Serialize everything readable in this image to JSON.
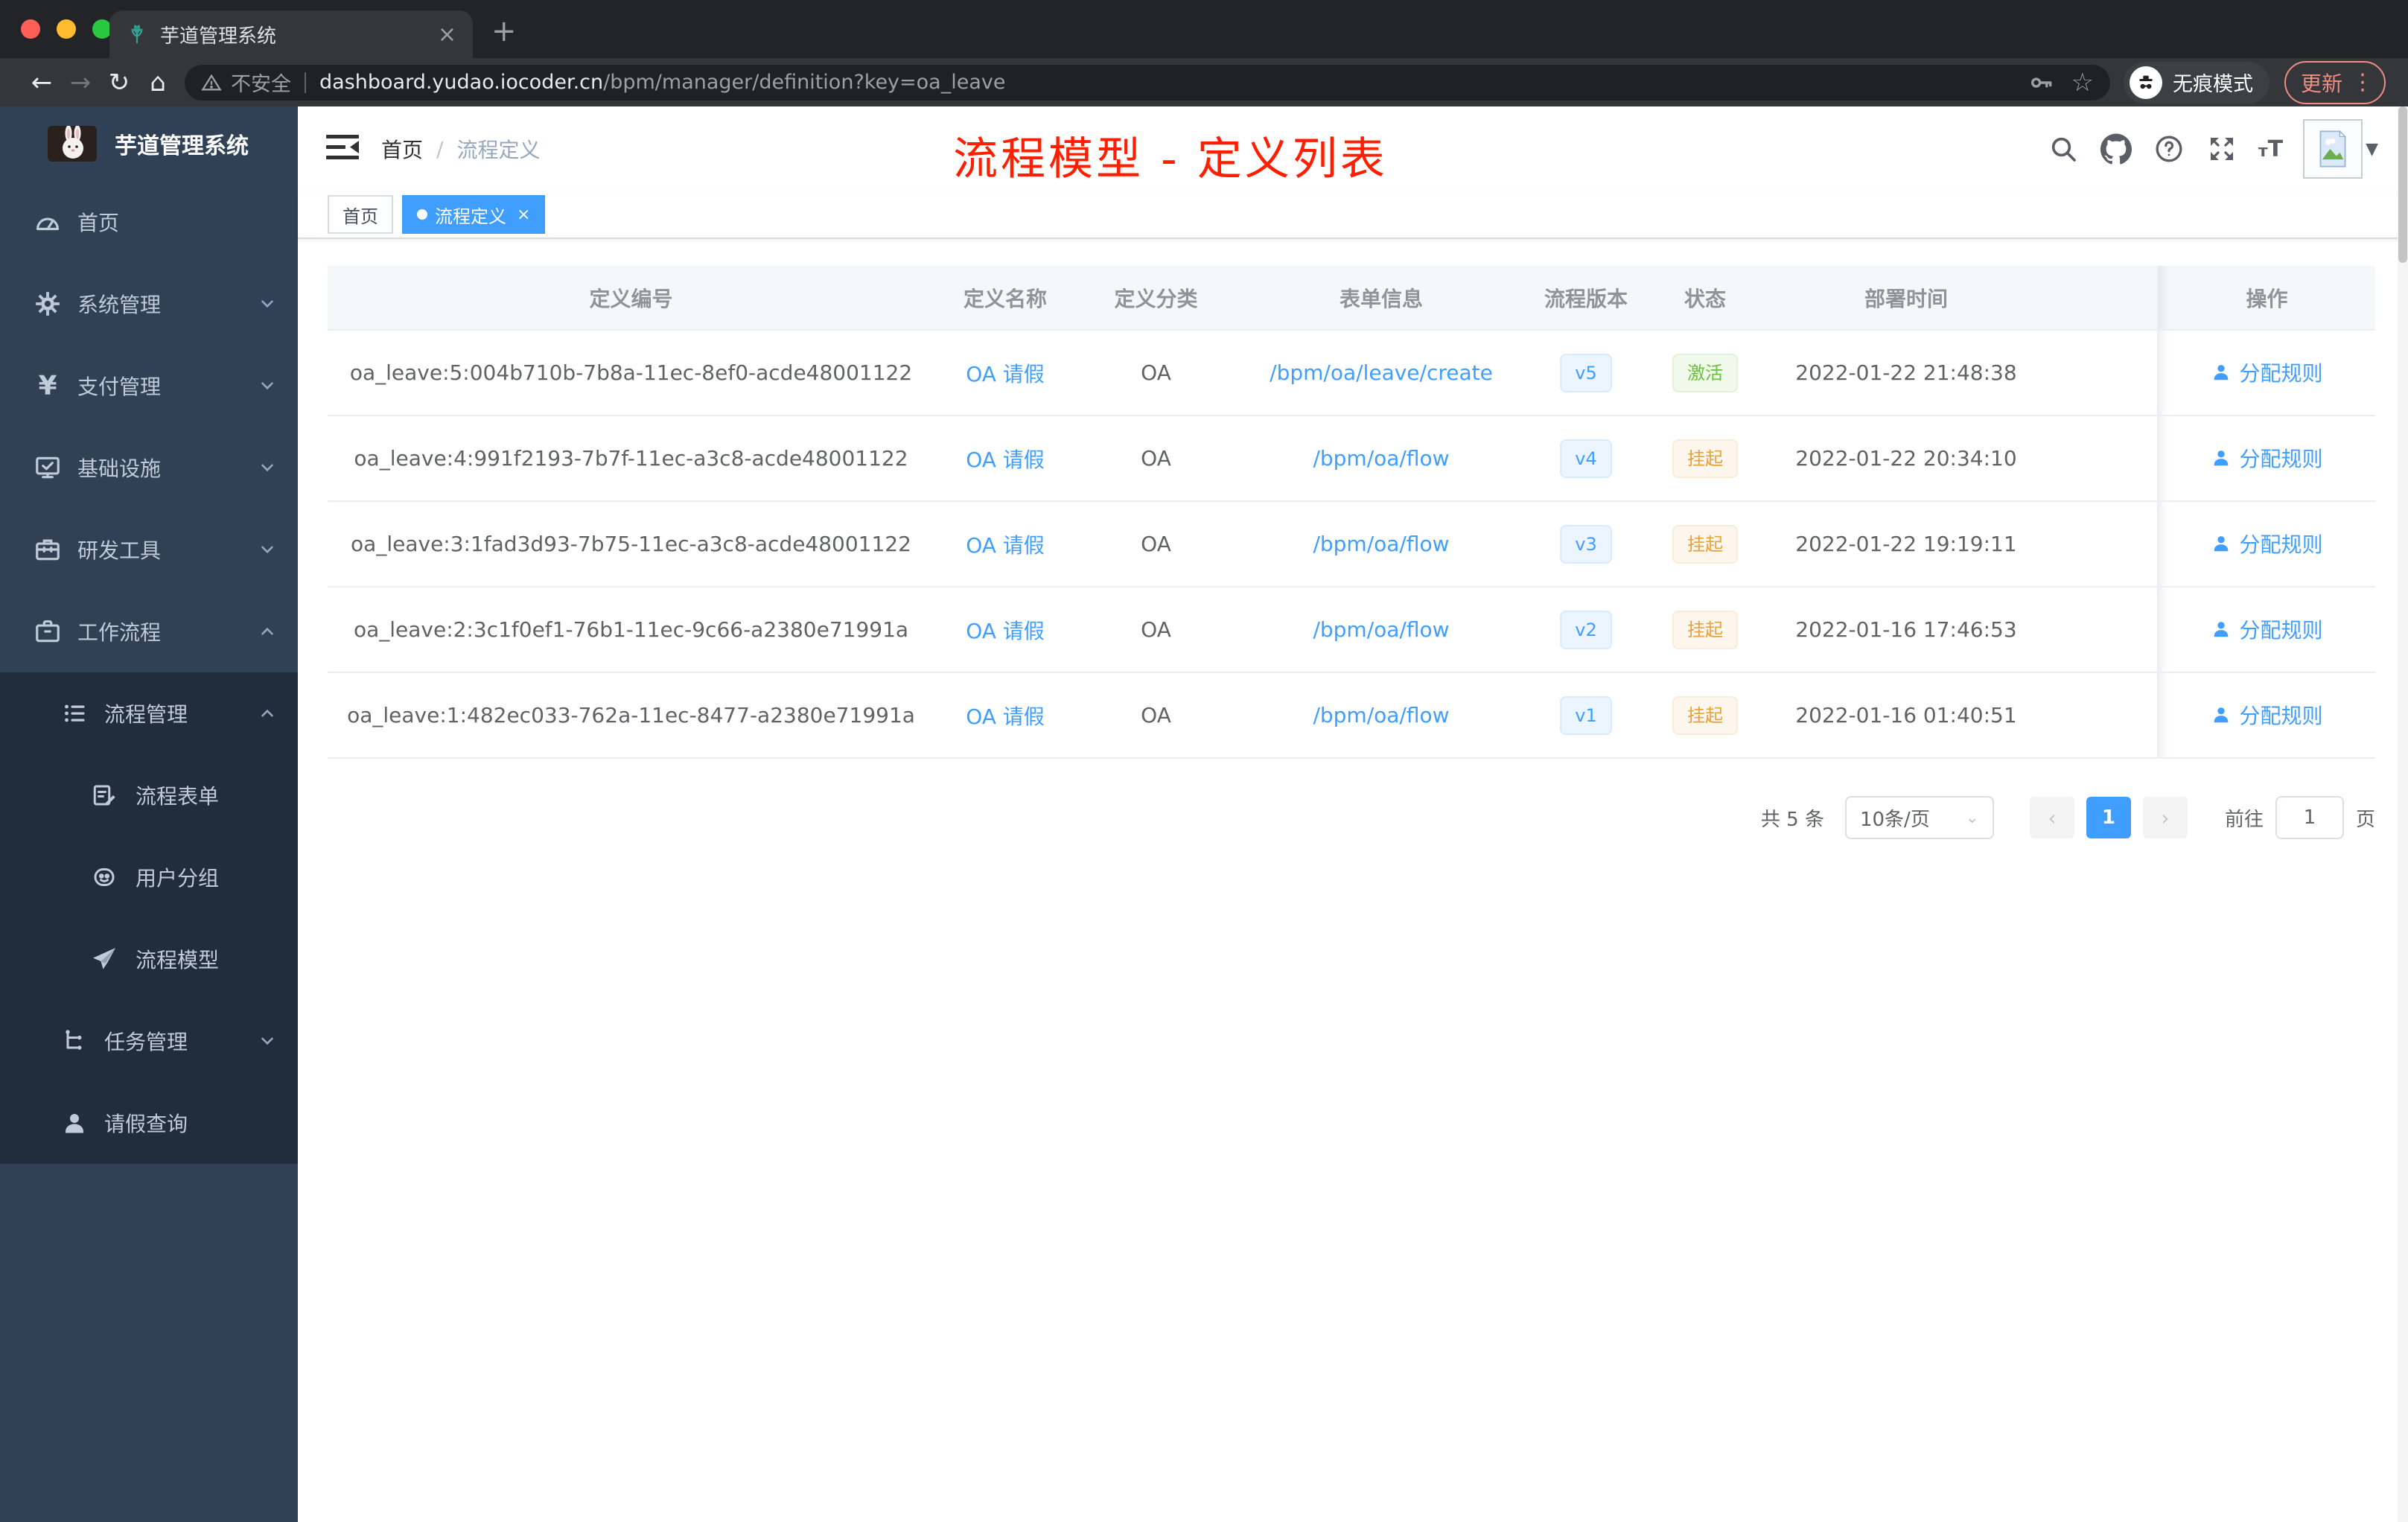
{
  "browser": {
    "tab_title": "芋道管理系统",
    "close_tab": "×",
    "new_tab": "+",
    "back": "←",
    "forward": "→",
    "reload": "↻",
    "home": "⌂",
    "security_label": "不安全",
    "url_domain": "dashboard.yudao.iocoder.cn",
    "url_path": "/bpm/manager/definition?key=oa_leave",
    "star": "☆",
    "incognito_label": "无痕模式",
    "update_label": "更新",
    "menu_dots": "⋮"
  },
  "sidebar": {
    "logo_title": "芋道管理系统",
    "menu": [
      {
        "label": "首页",
        "icon": "dashboard-icon"
      },
      {
        "label": "系统管理",
        "icon": "gear-icon"
      },
      {
        "label": "支付管理",
        "icon": "yen-icon"
      },
      {
        "label": "基础设施",
        "icon": "monitor-icon"
      },
      {
        "label": "研发工具",
        "icon": "toolbox-icon"
      },
      {
        "label": "工作流程",
        "icon": "briefcase-icon"
      }
    ],
    "submenu": [
      {
        "label": "流程管理",
        "icon": "ordered-list-icon"
      },
      {
        "label": "流程表单",
        "icon": "form-edit-icon"
      },
      {
        "label": "用户分组",
        "icon": "face-icon"
      },
      {
        "label": "流程模型",
        "icon": "paper-plane-icon"
      },
      {
        "label": "任务管理",
        "icon": "tree-icon"
      },
      {
        "label": "请假查询",
        "icon": "person-icon"
      }
    ]
  },
  "header": {
    "breadcrumb_home": "首页",
    "breadcrumb_separator": "/",
    "breadcrumb_current": "流程定义",
    "fontsize_small": "т",
    "fontsize_big": "T",
    "avatar_caret": "▼"
  },
  "annotation": "流程模型 - 定义列表",
  "tags": {
    "home": "首页",
    "active": "流程定义",
    "close": "×"
  },
  "table": {
    "columns": [
      "定义编号",
      "定义名称",
      "定义分类",
      "表单信息",
      "流程版本",
      "状态",
      "部署时间",
      "操作"
    ],
    "rows": [
      {
        "id": "oa_leave:5:004b710b-7b8a-11ec-8ef0-acde48001122",
        "name": "OA 请假",
        "category": "OA",
        "form": "/bpm/oa/leave/create",
        "version": "v5",
        "status": "激活",
        "deploy_time": "2022-01-22 21:48:38",
        "action": "分配规则"
      },
      {
        "id": "oa_leave:4:991f2193-7b7f-11ec-a3c8-acde48001122",
        "name": "OA 请假",
        "category": "OA",
        "form": "/bpm/oa/flow",
        "version": "v4",
        "status": "挂起",
        "deploy_time": "2022-01-22 20:34:10",
        "action": "分配规则"
      },
      {
        "id": "oa_leave:3:1fad3d93-7b75-11ec-a3c8-acde48001122",
        "name": "OA 请假",
        "category": "OA",
        "form": "/bpm/oa/flow",
        "version": "v3",
        "status": "挂起",
        "deploy_time": "2022-01-22 19:19:11",
        "action": "分配规则"
      },
      {
        "id": "oa_leave:2:3c1f0ef1-76b1-11ec-9c66-a2380e71991a",
        "name": "OA 请假",
        "category": "OA",
        "form": "/bpm/oa/flow",
        "version": "v2",
        "status": "挂起",
        "deploy_time": "2022-01-16 17:46:53",
        "action": "分配规则"
      },
      {
        "id": "oa_leave:1:482ec033-762a-11ec-8477-a2380e71991a",
        "name": "OA 请假",
        "category": "OA",
        "form": "/bpm/oa/flow",
        "version": "v1",
        "status": "挂起",
        "deploy_time": "2022-01-16 01:40:51",
        "action": "分配规则"
      }
    ]
  },
  "pagination": {
    "total": "共 5 条",
    "page_size": "10条/页",
    "size_caret": "⌄",
    "prev": "‹",
    "next": "›",
    "current_page": "1",
    "goto_label": "前往",
    "goto_value": "1",
    "page_unit": "页"
  },
  "colors": {
    "accent_blue": "#409eff",
    "success_green": "#67c23a",
    "warning_orange": "#e6a23c",
    "annotation_red": "#fe1e00",
    "sidebar_bg": "#304156",
    "submenu_bg": "#1f2d3d"
  }
}
